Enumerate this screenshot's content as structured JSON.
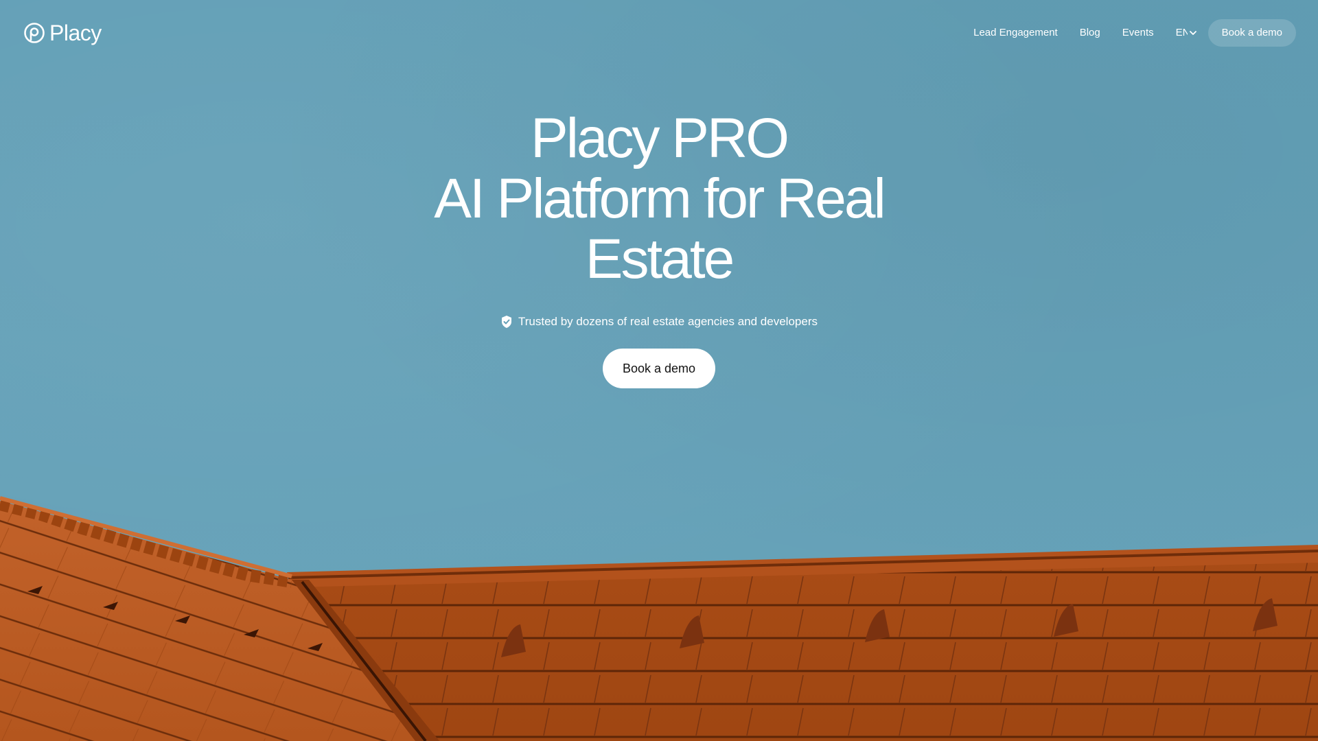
{
  "brand": {
    "name": "Placy",
    "logo_icon": "placy-logo-icon"
  },
  "nav": {
    "items": [
      {
        "label": "Lead Engagement"
      },
      {
        "label": "Blog"
      },
      {
        "label": "Events"
      }
    ],
    "language": {
      "label": "EN",
      "icon": "chevron-down-icon"
    },
    "cta_label": "Book a demo"
  },
  "hero": {
    "title_line1": "Placy PRO",
    "title_line2": "AI Platform for Real",
    "title_line3": "Estate",
    "trust_text": "Trusted by dozens of real estate agencies and developers",
    "trust_icon": "shield-check-icon",
    "cta_label": "Book a demo"
  },
  "colors": {
    "sky": "#64a0b7",
    "roof": "#b3521c",
    "cta_bg": "#ffffff",
    "text": "#ffffff"
  }
}
